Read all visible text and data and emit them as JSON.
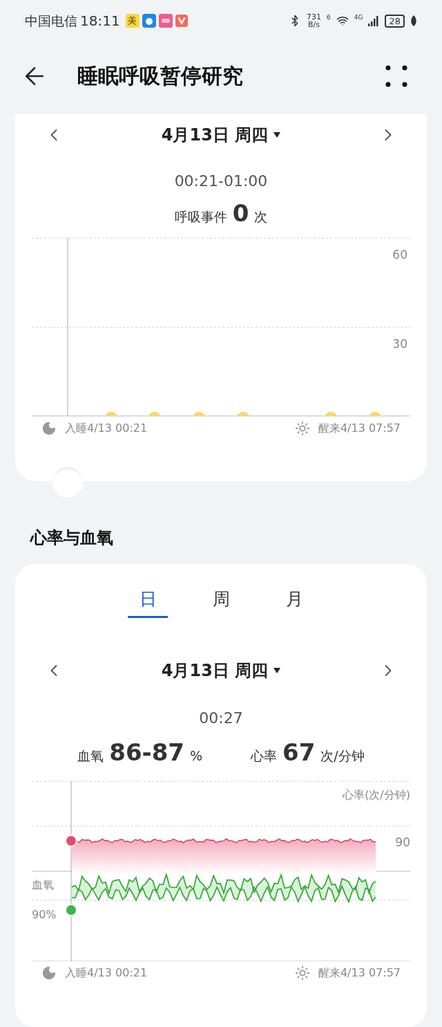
{
  "status_bar": {
    "carrier": "中国电信",
    "time": "18:11",
    "app_badge": "美",
    "speed_value": "731",
    "speed_unit": "B/s",
    "wifi_label": "6",
    "network": "4G",
    "battery": "28"
  },
  "header": {
    "title": "睡眠呼吸暂停研究"
  },
  "apnea_card": {
    "date": "4月13日 周四",
    "time_range": "00:21-01:00",
    "events_label": "呼吸事件",
    "events_count": "0",
    "events_unit": "次",
    "yticks": [
      "60",
      "30"
    ],
    "sleep": "入睡4/13 00:21",
    "wake": "醒来4/13 07:57"
  },
  "section_title": "心率与血氧",
  "tabs": [
    {
      "label": "日",
      "selected": true
    },
    {
      "label": "周",
      "selected": false
    },
    {
      "label": "月",
      "selected": false
    }
  ],
  "heart_card": {
    "date": "4月13日 周四",
    "time": "00:27",
    "spo2_label": "血氧",
    "spo2_value": "86-87",
    "spo2_unit": "%",
    "hr_label": "心率",
    "hr_value": "67",
    "hr_unit": "次/分钟",
    "hr_axis_label": "心率(次/分钟)",
    "hr_tick": "90",
    "spo2_axis_label": "血氧",
    "spo2_tick": "90%",
    "sleep": "入睡4/13 00:21",
    "wake": "醒来4/13 07:57"
  }
}
